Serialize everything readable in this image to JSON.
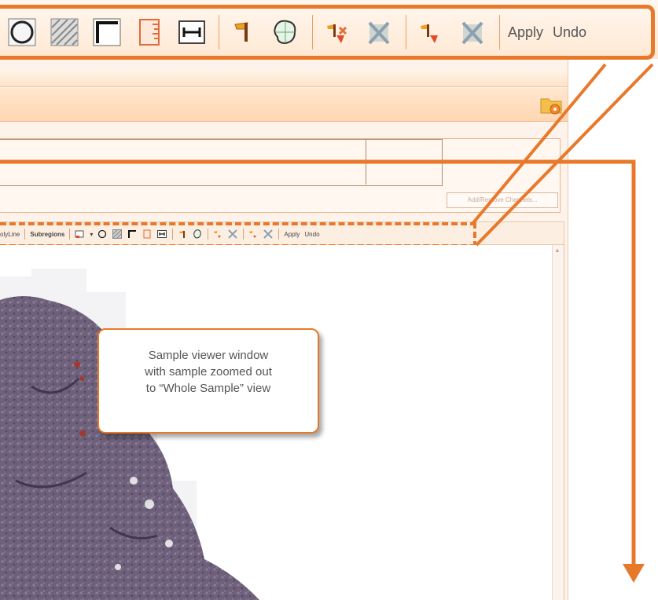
{
  "zoomed_toolbar": {
    "apply_label": "Apply",
    "undo_label": "Undo"
  },
  "small_toolbar": {
    "polyline_label": "olyLine",
    "subregions_label": "Subregions",
    "apply_label": "Apply",
    "undo_label": "Undo"
  },
  "panel": {
    "add_remove_label": "Add/Remove Channels..."
  },
  "callout": {
    "line1": "Sample viewer window",
    "line2": "with sample zoomed out",
    "line3": "to “Whole Sample” view"
  },
  "colors": {
    "accent": "#e8782a",
    "tissue": "#6e607a",
    "toolbar_bg": "#fdeee2"
  }
}
